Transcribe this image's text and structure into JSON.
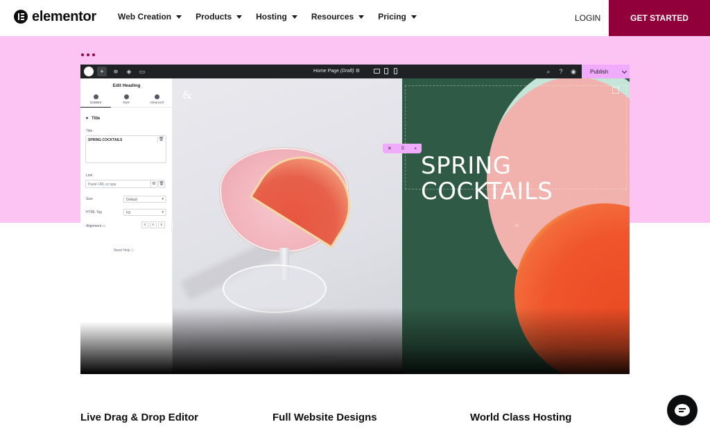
{
  "brand": {
    "logo_text": "elementor"
  },
  "nav": {
    "items": [
      {
        "label": "Web Creation"
      },
      {
        "label": "Products"
      },
      {
        "label": "Hosting"
      },
      {
        "label": "Resources"
      },
      {
        "label": "Pricing"
      }
    ],
    "login": "LOGIN",
    "cta": "GET STARTED"
  },
  "colors": {
    "brand": "#92003b",
    "hero_bg": "#fbc4f2",
    "publish_bg": "#f0abfc",
    "editor_dark": "#1f2124",
    "panel_green": "#2f5a46"
  },
  "editor": {
    "page_title": "Home Page",
    "page_status": "(Draft)",
    "publish_label": "Publish",
    "panel": {
      "title": "Edit Heading",
      "tabs": [
        {
          "label": "Content"
        },
        {
          "label": "Style"
        },
        {
          "label": "Advanced"
        }
      ],
      "section": "Title",
      "title_label": "Title",
      "title_value": "SPRING COCKTAILS",
      "link_label": "Link",
      "link_placeholder": "Paste URL or type",
      "size_label": "Size",
      "size_value": "Default",
      "tag_label": "HTML Tag",
      "tag_value": "H2",
      "alignment_label": "Alignment",
      "need_help": "Need Help"
    },
    "canvas": {
      "heading": "SPRING COCKTAILS",
      "heading_line1": "SPRING",
      "heading_line2": "COCKTAILS"
    }
  },
  "features": [
    {
      "label": "Live Drag & Drop Editor"
    },
    {
      "label": "Full Website Designs"
    },
    {
      "label": "World Class Hosting"
    }
  ]
}
